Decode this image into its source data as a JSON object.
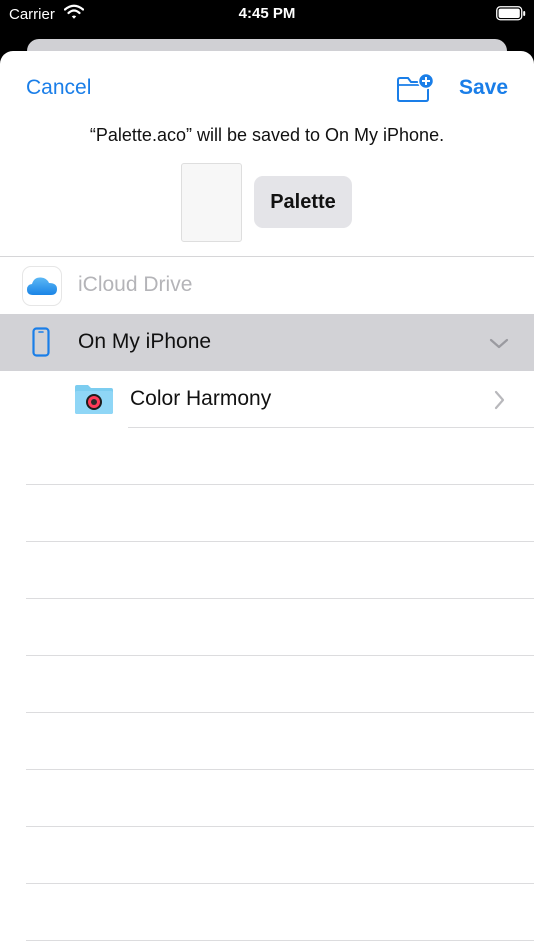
{
  "status_bar": {
    "carrier": "Carrier",
    "time": "4:45 PM"
  },
  "nav": {
    "cancel_label": "Cancel",
    "save_label": "Save"
  },
  "save_message": "“Palette.aco” will be saved to On My iPhone.",
  "filename": "Palette",
  "locations": [
    {
      "label": "iCloud Drive",
      "icon": "icloud-icon",
      "enabled": false
    },
    {
      "label": "On My iPhone",
      "icon": "iphone-icon",
      "selected": true,
      "expanded": true
    }
  ],
  "folders": [
    {
      "label": "Color Harmony",
      "icon": "folder-icon"
    }
  ],
  "colors": {
    "accent": "#1a7ee8",
    "selected_row": "#d2d2d6",
    "disabled_text": "#b4b4b8"
  }
}
